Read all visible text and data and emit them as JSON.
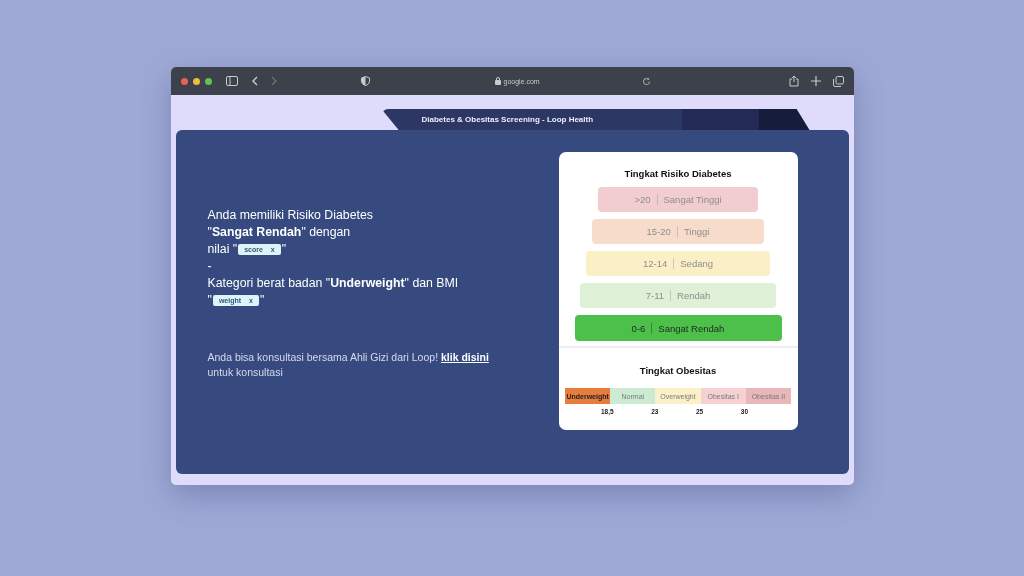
{
  "browser": {
    "url": "google.com"
  },
  "tab": {
    "title": "Diabetes & Obesitas Screening - Loop Health"
  },
  "result": {
    "lines": [
      {
        "kind": "text",
        "text": "Anda memiliki Risiko Diabetes"
      },
      {
        "kind": "text",
        "text": "\"**Sangat Rendah**\" dengan"
      },
      {
        "kind": "chip",
        "before": "nilai \"",
        "chip": "score",
        "close": "x",
        "after": "\""
      },
      {
        "kind": "text",
        "text": "-"
      },
      {
        "kind": "text",
        "text": "Kategori berat badan \"**Underweight**\" dan BMI"
      },
      {
        "kind": "chip",
        "before": "\"",
        "chip": "weight",
        "close": "x",
        "after": "\""
      }
    ],
    "consult": {
      "text": "Anda bisa konsultasi bersama Ahli Gizi dari Loop!",
      "link": "klik disini",
      "after": "untuk konsultasi"
    }
  },
  "diabetes": {
    "title": "Tingkat Risiko Diabetes",
    "levels": [
      {
        "range": ">20",
        "label": "Sangat Tinggi",
        "color": "#f2cdd0",
        "selected": false
      },
      {
        "range": "15-20",
        "label": "Tinggi",
        "color": "#f8dccb",
        "selected": false
      },
      {
        "range": "12-14",
        "label": "Sedang",
        "color": "#fbefc6",
        "selected": false
      },
      {
        "range": "7-11",
        "label": "Rendah",
        "color": "#def0d6",
        "selected": false
      },
      {
        "range": "0-6",
        "label": "Sangat Rendah",
        "color": "#4cc04a",
        "selected": true
      }
    ]
  },
  "obesity": {
    "title": "Tingkat Obesitas",
    "segments": [
      {
        "label": "Underweight",
        "color": "#e77c3d",
        "selected": true
      },
      {
        "label": "Normal",
        "color": "#cdebd2",
        "selected": false
      },
      {
        "label": "Overweight",
        "color": "#fbf1c8",
        "selected": false
      },
      {
        "label": "Obesitas I",
        "color": "#f7d0d3",
        "selected": false
      },
      {
        "label": "Obesitas II",
        "color": "#e9b6b9",
        "selected": false
      }
    ],
    "ticks": [
      "18,5",
      "23",
      "25",
      "30"
    ]
  }
}
